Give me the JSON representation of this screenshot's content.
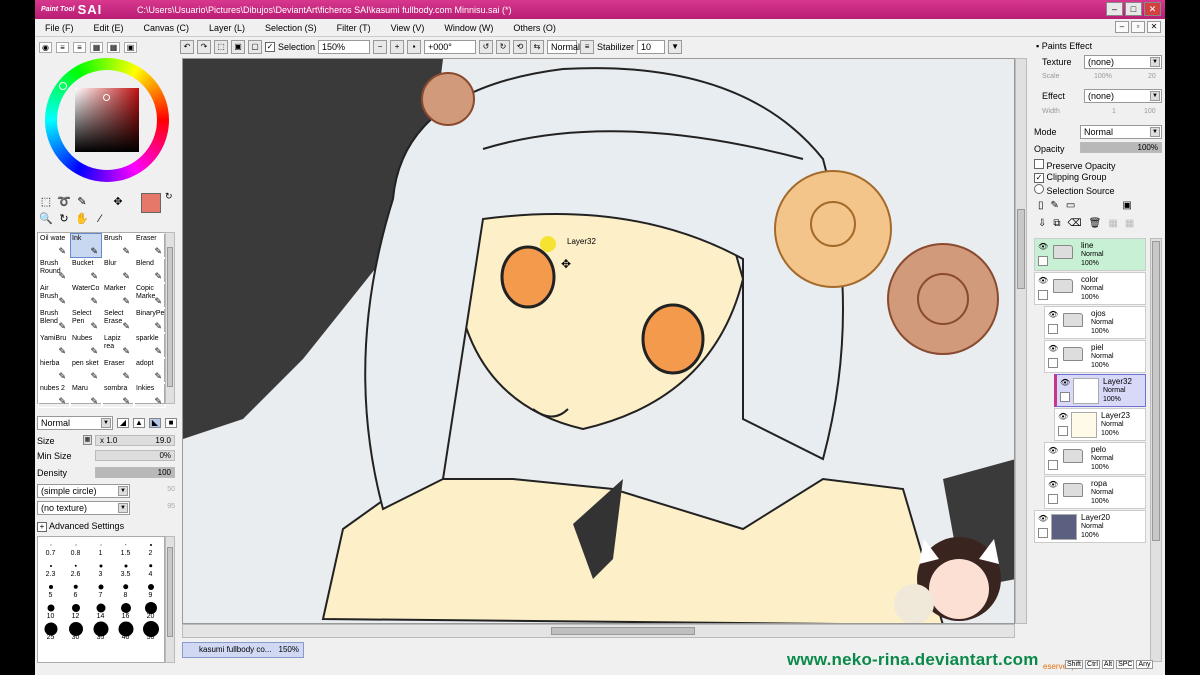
{
  "window": {
    "logo_small": "Paint Tool",
    "logo_big": "SAI",
    "title": "C:\\Users\\Usuario\\Pictures\\Dibujos\\DeviantArt\\ficheros SAI\\kasumi fullbody.com Minnisu.sai (*)"
  },
  "menu": [
    "File (F)",
    "Edit (E)",
    "Canvas (C)",
    "Layer (L)",
    "Selection (S)",
    "Filter (T)",
    "View (V)",
    "Window (W)",
    "Others (O)"
  ],
  "toolbar": {
    "selection_label": "Selection",
    "zoom": "150%",
    "angle": "+000°",
    "mode": "Normal",
    "stabilizer_label": "Stabilizer",
    "stabilizer_value": "10"
  },
  "colors": {
    "primary": "#e6786a",
    "secondary": "#f0c4b8",
    "accent": "#c8348a"
  },
  "brushes": [
    {
      "name": "Oil wate",
      "selected": false
    },
    {
      "name": "Ink",
      "selected": true
    },
    {
      "name": "Brush",
      "selected": false
    },
    {
      "name": "Eraser",
      "selected": false
    },
    {
      "name": "Brush Round",
      "selected": false
    },
    {
      "name": "Bucket",
      "selected": false
    },
    {
      "name": "Blur",
      "selected": false
    },
    {
      "name": "Blend",
      "selected": false
    },
    {
      "name": "Air Brush",
      "selected": false
    },
    {
      "name": "WaterCo",
      "selected": false
    },
    {
      "name": "Marker",
      "selected": false
    },
    {
      "name": "Copic Marke",
      "selected": false
    },
    {
      "name": "Brush Blend",
      "selected": false
    },
    {
      "name": "Select Pen",
      "selected": false
    },
    {
      "name": "Select Erase",
      "selected": false
    },
    {
      "name": "BinaryPe",
      "selected": false
    },
    {
      "name": "YamiBru",
      "selected": false
    },
    {
      "name": "Nubes",
      "selected": false
    },
    {
      "name": "Lapiz rea",
      "selected": false
    },
    {
      "name": "sparkle",
      "selected": false
    },
    {
      "name": "hierba",
      "selected": false
    },
    {
      "name": "pen sket",
      "selected": false
    },
    {
      "name": "Eraser",
      "selected": false
    },
    {
      "name": "adopt",
      "selected": false
    },
    {
      "name": "nubes 2",
      "selected": false
    },
    {
      "name": "Maru",
      "selected": false
    },
    {
      "name": "sombra",
      "selected": false
    },
    {
      "name": "Inkies",
      "selected": false
    }
  ],
  "brush_settings": {
    "blend_mode": "Normal",
    "size_label": "Size",
    "size_multiplier": "x 1.0",
    "size_value": "19.0",
    "min_size_label": "Min Size",
    "min_size_value": "0%",
    "min_size_fraction": 0.0,
    "density_label": "Density",
    "density_value": "100",
    "density_fraction": 1.0,
    "shape": "(simple circle)",
    "shape_value": "50",
    "texture": "(no texture)",
    "texture_value": "95",
    "advanced_label": "Advanced Settings"
  },
  "brush_sizes": [
    {
      "label": "0.7",
      "d": 1
    },
    {
      "label": "0.8",
      "d": 1
    },
    {
      "label": "1",
      "d": 1
    },
    {
      "label": "1.5",
      "d": 1.5
    },
    {
      "label": "2",
      "d": 2
    },
    {
      "label": "2.3",
      "d": 2
    },
    {
      "label": "2.6",
      "d": 2.5
    },
    {
      "label": "3",
      "d": 3
    },
    {
      "label": "3.5",
      "d": 3
    },
    {
      "label": "4",
      "d": 3.5
    },
    {
      "label": "5",
      "d": 4
    },
    {
      "label": "6",
      "d": 4.5
    },
    {
      "label": "7",
      "d": 5
    },
    {
      "label": "8",
      "d": 5.5
    },
    {
      "label": "9",
      "d": 6
    },
    {
      "label": "10",
      "d": 7
    },
    {
      "label": "12",
      "d": 8
    },
    {
      "label": "14",
      "d": 9
    },
    {
      "label": "16",
      "d": 10
    },
    {
      "label": "20",
      "d": 12
    },
    {
      "label": "25",
      "d": 13
    },
    {
      "label": "30",
      "d": 14
    },
    {
      "label": "35",
      "d": 15
    },
    {
      "label": "40",
      "d": 15
    },
    {
      "label": "50",
      "d": 16
    }
  ],
  "paint_effect": {
    "title": "Paints Effect",
    "texture_label": "Texture",
    "texture_value": "(none)",
    "scale_label": "Scale",
    "scale_value": "100%",
    "scale_right": "20",
    "effect_label": "Effect",
    "effect_value": "(none)",
    "width_label": "Width",
    "width_value": "1",
    "width_right": "100",
    "mode_label": "Mode",
    "mode_value": "Normal",
    "opacity_label": "Opacity",
    "opacity_value": "100%",
    "opacity_fraction": 1.0,
    "preserve_opacity": "Preserve Opacity",
    "clipping_group": "Clipping Group",
    "selection_source": "Selection Source"
  },
  "layers": [
    {
      "name": "line",
      "mode": "Normal",
      "opacity": "100%",
      "type": "folder",
      "indent": 0,
      "selected": false,
      "highlight": "green",
      "thumb": "#ffffff"
    },
    {
      "name": "color",
      "mode": "Normal",
      "opacity": "100%",
      "type": "folder",
      "indent": 0,
      "selected": false,
      "highlight": "",
      "thumb": "#ffffff"
    },
    {
      "name": "ojos",
      "mode": "Normal",
      "opacity": "100%",
      "type": "folder",
      "indent": 1,
      "selected": false,
      "highlight": "",
      "thumb": "#ffffff"
    },
    {
      "name": "piel",
      "mode": "Normal",
      "opacity": "100%",
      "type": "folder",
      "indent": 1,
      "selected": false,
      "highlight": "",
      "thumb": "#ffffff"
    },
    {
      "name": "Layer32",
      "mode": "Normal",
      "opacity": "100%",
      "type": "layer",
      "indent": 2,
      "selected": true,
      "highlight": "",
      "thumb": "#ffffff"
    },
    {
      "name": "Layer23",
      "mode": "Normal",
      "opacity": "100%",
      "type": "layer",
      "indent": 2,
      "selected": false,
      "highlight": "",
      "thumb": "#fffbe8"
    },
    {
      "name": "pelo",
      "mode": "Normal",
      "opacity": "100%",
      "type": "folder",
      "indent": 1,
      "selected": false,
      "highlight": "",
      "thumb": "#ffffff"
    },
    {
      "name": "ropa",
      "mode": "Normal",
      "opacity": "100%",
      "type": "folder",
      "indent": 1,
      "selected": false,
      "highlight": "",
      "thumb": "#ffffff"
    },
    {
      "name": "Layer20",
      "mode": "Normal",
      "opacity": "100%",
      "type": "layer",
      "indent": 0,
      "selected": false,
      "highlight": "",
      "thumb": "#5c6080"
    }
  ],
  "canvas": {
    "cursor_label": "Layer32",
    "document_tab": "kasumi fullbody co...",
    "document_zoom": "150%",
    "watermark": "www.neko-rina.deviantart.com",
    "reserved_text": "eserved)"
  },
  "statusbar": [
    "Shift",
    "Ctrl",
    "Alt",
    "SPC",
    "Any"
  ]
}
